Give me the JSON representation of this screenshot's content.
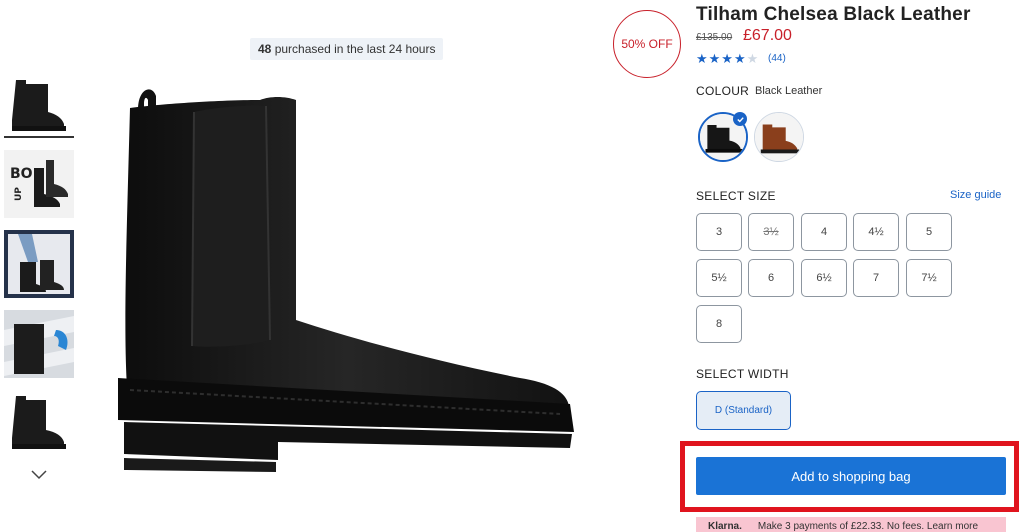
{
  "purchased": {
    "count": "48",
    "text": "purchased in the last 24 hours"
  },
  "discount": "50% OFF",
  "product": {
    "title": "Tilham Chelsea Black Leather",
    "price_old": "£135.00",
    "price_new": "£67.00",
    "rating_stars": "★★★★",
    "rating_empty": "★",
    "reviews": "(44)"
  },
  "colour": {
    "label": "COLOUR",
    "value": "Black Leather",
    "swatches": [
      "black-leather",
      "tan-leather"
    ]
  },
  "size": {
    "label": "SELECT SIZE",
    "guide": "Size guide",
    "options": [
      "3",
      "3½",
      "4",
      "4½",
      "5",
      "5½",
      "6",
      "6½",
      "7",
      "7½",
      "8"
    ],
    "unavailable": [
      "3½"
    ]
  },
  "width": {
    "label": "SELECT WIDTH",
    "selected": "D (Standard)"
  },
  "cart": {
    "add_label": "Add to shopping bag"
  },
  "klarna": {
    "brand": "Klarna.",
    "text": "Make 3 payments of £22.33. No fees. Learn more"
  },
  "icons": [
    "chevron-down-icon",
    "check-icon"
  ],
  "colors": {
    "accent": "#1a63c6",
    "sale": "#c8202a",
    "highlight": "#e0141e",
    "klarna": "#f9c5d1"
  }
}
